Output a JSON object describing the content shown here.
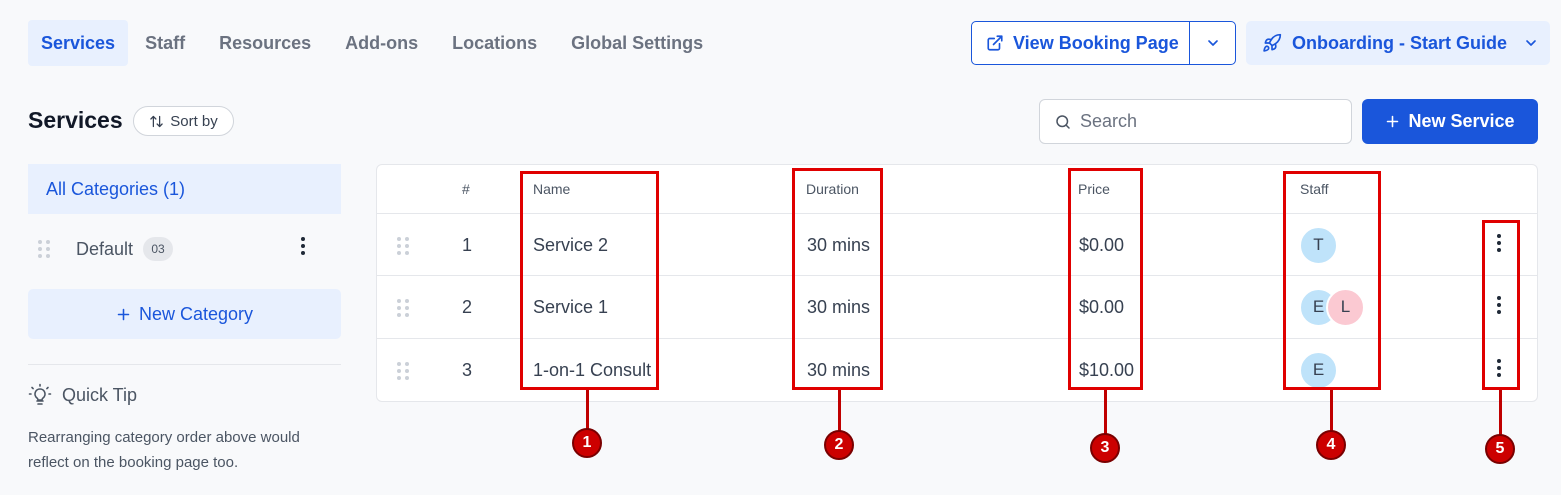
{
  "nav": {
    "tabs": [
      "Services",
      "Staff",
      "Resources",
      "Add-ons",
      "Locations",
      "Global Settings"
    ],
    "view_booking_label": "View Booking Page",
    "onboarding_label": "Onboarding - Start Guide"
  },
  "sidebar": {
    "title": "Services",
    "sort_label": "Sort by",
    "all_categories": "All Categories (1)",
    "categories": [
      {
        "label": "Default",
        "count": "03"
      }
    ],
    "new_category_label": "New Category",
    "tip_title": "Quick Tip",
    "tip_text": "Rearranging category order above would reflect on the booking page too."
  },
  "toolbar": {
    "search_placeholder": "Search",
    "new_service_label": "New Service"
  },
  "table": {
    "headers": {
      "num": "#",
      "name": "Name",
      "duration": "Duration",
      "price": "Price",
      "staff": "Staff"
    },
    "rows": [
      {
        "num": "1",
        "name": "Service 2",
        "duration": "30 mins",
        "price": "$0.00",
        "staff": [
          "T"
        ]
      },
      {
        "num": "2",
        "name": "Service 1",
        "duration": "30 mins",
        "price": "$0.00",
        "staff": [
          "E",
          "L"
        ]
      },
      {
        "num": "3",
        "name": "1-on-1 Consult",
        "duration": "30 mins",
        "price": "$10.00",
        "staff": [
          "E"
        ]
      }
    ]
  },
  "annotations": [
    "1",
    "2",
    "3",
    "4",
    "5"
  ],
  "colors": {
    "accent": "#1a56db",
    "accent_light": "#e8f0fe",
    "annotation": "#cc0000",
    "avatar_blue": "#bfe3fa",
    "avatar_pink": "#fbc9d2"
  }
}
